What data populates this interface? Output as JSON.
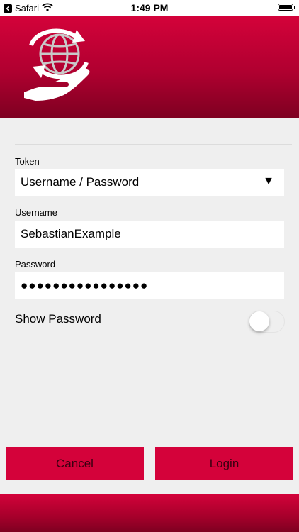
{
  "status_bar": {
    "app": "Safari",
    "time": "1:49 PM",
    "battery_level": 1.0
  },
  "header": {
    "logo_icon": "globe-hand-logo-icon"
  },
  "form": {
    "token": {
      "label": "Token",
      "value": "Username / Password",
      "arrow": "▼"
    },
    "username": {
      "label": "Username",
      "value": "SebastianExample"
    },
    "password": {
      "label": "Password",
      "value": "●●●●●●●●●●●●●●●●"
    },
    "show_password": {
      "label": "Show Password",
      "enabled": false
    }
  },
  "buttons": {
    "cancel": "Cancel",
    "login": "Login"
  },
  "colors": {
    "brand": "#d4023a",
    "brand_dark": "#7e0021",
    "background": "#efefef"
  }
}
